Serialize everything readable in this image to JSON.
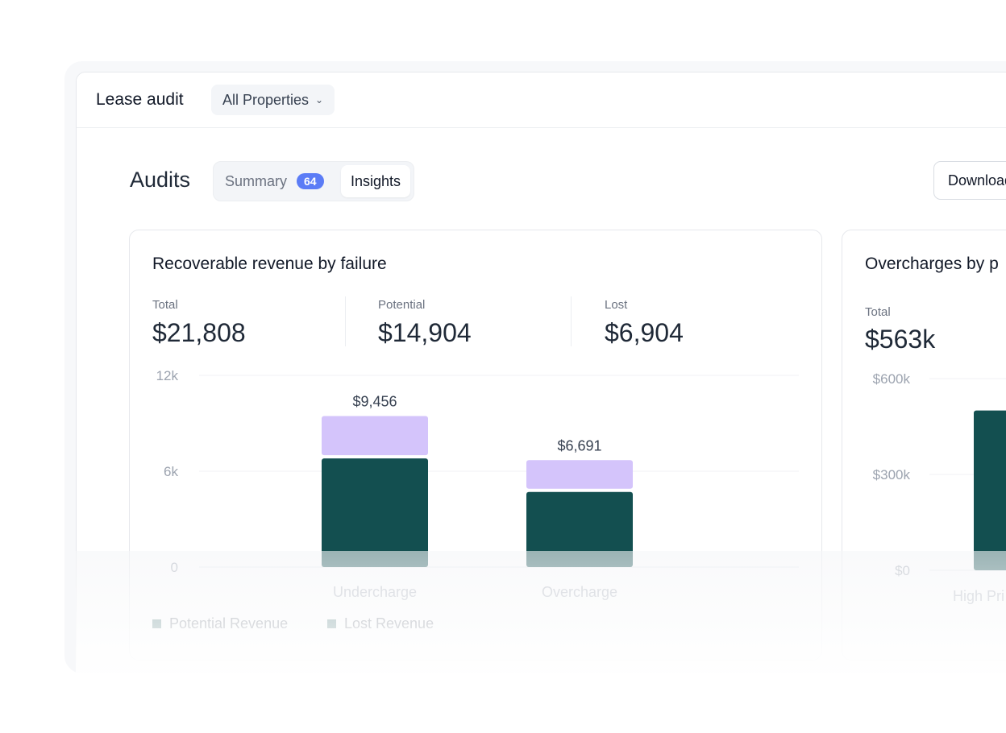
{
  "app": {
    "title": "Lease audit",
    "property_filter": "All Properties"
  },
  "page": {
    "title": "Audits",
    "tabs": [
      {
        "label": "Summary",
        "badge": "64"
      },
      {
        "label": "Insights"
      }
    ],
    "download_label": "Download"
  },
  "card1": {
    "title": "Recoverable revenue by failure",
    "stats": [
      {
        "label": "Total",
        "value": "$21,808"
      },
      {
        "label": "Potential",
        "value": "$14,904"
      },
      {
        "label": "Lost",
        "value": "$6,904"
      }
    ],
    "legend": [
      "Potential Revenue",
      "Lost Revenue"
    ]
  },
  "card2": {
    "title": "Overcharges by p",
    "stats": [
      {
        "label": "Total",
        "value": "$563k"
      }
    ]
  },
  "colors": {
    "lost": "#134f50",
    "potential": "#d4c4fb",
    "accent": "#5b7cf6"
  },
  "chart_data": [
    {
      "type": "bar",
      "stacked": true,
      "categories": [
        "Undercharge",
        "Overcharge"
      ],
      "series": [
        {
          "name": "Lost Revenue",
          "values": [
            6800,
            4700
          ]
        },
        {
          "name": "Potential Revenue",
          "values": [
            2656,
            1991
          ]
        }
      ],
      "totals_labels": [
        "$9,456",
        "$6,691"
      ],
      "ylim": [
        0,
        12000
      ],
      "yticks": [
        0,
        6000,
        12000
      ],
      "ytick_labels": [
        "0",
        "6k",
        "12k"
      ],
      "grid": true,
      "legend_position": "bottom-left"
    },
    {
      "type": "bar",
      "categories": [
        "High Pri"
      ],
      "series": [
        {
          "values": [
            500000
          ]
        }
      ],
      "ylim": [
        0,
        600000
      ],
      "yticks": [
        0,
        300000,
        600000
      ],
      "ytick_labels": [
        "$0",
        "$300k",
        "$600k"
      ],
      "grid": true
    }
  ]
}
